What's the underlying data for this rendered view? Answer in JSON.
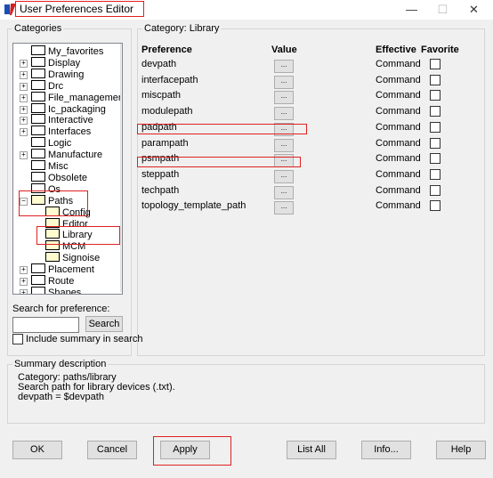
{
  "window": {
    "title": "User Preferences Editor",
    "minimize_glyph": "—",
    "maximize_glyph": "☐",
    "close_glyph": "✕"
  },
  "categories": {
    "label": "Categories",
    "tree": [
      {
        "label": "My_favorites",
        "expander": ""
      },
      {
        "label": "Display",
        "expander": "+"
      },
      {
        "label": "Drawing",
        "expander": "+"
      },
      {
        "label": "Drc",
        "expander": "+"
      },
      {
        "label": "File_management",
        "expander": "+"
      },
      {
        "label": "Ic_packaging",
        "expander": "+"
      },
      {
        "label": "Interactive",
        "expander": "+"
      },
      {
        "label": "Interfaces",
        "expander": "+"
      },
      {
        "label": "Logic",
        "expander": ""
      },
      {
        "label": "Manufacture",
        "expander": "+"
      },
      {
        "label": "Misc",
        "expander": ""
      },
      {
        "label": "Obsolete",
        "expander": ""
      },
      {
        "label": "Os",
        "expander": ""
      },
      {
        "label": "Paths",
        "expander": "−"
      },
      {
        "label": "Config",
        "expander": ""
      },
      {
        "label": "Editor",
        "expander": ""
      },
      {
        "label": "Library",
        "expander": ""
      },
      {
        "label": "MCM",
        "expander": ""
      },
      {
        "label": "Signoise",
        "expander": ""
      },
      {
        "label": "Placement",
        "expander": "+"
      },
      {
        "label": "Route",
        "expander": "+"
      },
      {
        "label": "Shapes",
        "expander": "+"
      }
    ],
    "scroll_up": "▲",
    "scroll_down": "▼"
  },
  "search": {
    "label": "Search for preference:",
    "value": "",
    "button": "Search",
    "include_summary_label": "Include summary in search"
  },
  "main": {
    "category_label": "Category:",
    "category_value": "Library",
    "headers": {
      "preference": "Preference",
      "value": "Value",
      "effective": "Effective",
      "favorite": "Favorite"
    },
    "rows": [
      {
        "name": "devpath",
        "button": "...",
        "effective": "Command"
      },
      {
        "name": "interfacepath",
        "button": "...",
        "effective": "Command"
      },
      {
        "name": "miscpath",
        "button": "...",
        "effective": "Command"
      },
      {
        "name": "modulepath",
        "button": "...",
        "effective": "Command"
      },
      {
        "name": "padpath",
        "button": "...",
        "effective": "Command"
      },
      {
        "name": "parampath",
        "button": "...",
        "effective": "Command"
      },
      {
        "name": "psmpath",
        "button": "...",
        "effective": "Command"
      },
      {
        "name": "steppath",
        "button": "...",
        "effective": "Command"
      },
      {
        "name": "techpath",
        "button": "...",
        "effective": "Command"
      },
      {
        "name": "topology_template_path",
        "button": "...",
        "effective": "Command"
      }
    ]
  },
  "summary": {
    "label": "Summary description",
    "line1": "Category: paths/library",
    "line2": "Search path for library devices (.txt).",
    "line3": "devpath = $devpath"
  },
  "buttons": {
    "ok": "OK",
    "cancel": "Cancel",
    "apply": "Apply",
    "list_all": "List All",
    "info": "Info...",
    "help": "Help"
  },
  "colors": {
    "highlight_border": "#e02020",
    "dialog_background": "#f0f0f0"
  }
}
